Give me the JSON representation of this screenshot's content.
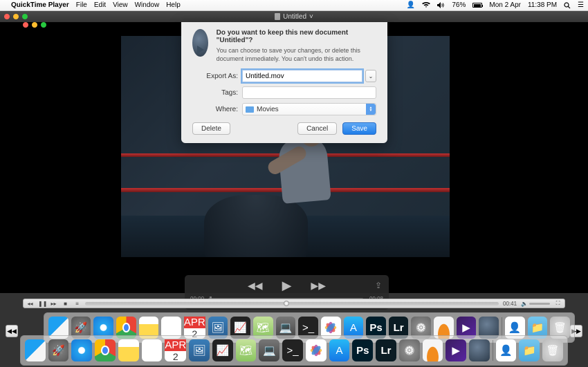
{
  "menubar": {
    "appname": "QuickTime Player",
    "items": [
      "File",
      "Edit",
      "View",
      "Window",
      "Help"
    ],
    "user_icon": "▲",
    "wifi": "wifi",
    "volume": "vol",
    "battery_pct": "76%",
    "date": "Mon 2 Apr",
    "time": "11:38 PM"
  },
  "window": {
    "title": "Untitled",
    "chevron": "˅"
  },
  "dialog": {
    "headline": "Do you want to keep this new document \"Untitled\"?",
    "subline": "You can choose to save your changes, or delete this document immediately. You can't undo this action.",
    "export_label": "Export As:",
    "export_value": "Untitled.mov",
    "tags_label": "Tags:",
    "where_label": "Where:",
    "where_value": "Movies",
    "delete": "Delete",
    "cancel": "Cancel",
    "save": "Save"
  },
  "qtcontrols": {
    "current": "00:00",
    "remaining": "-00:08"
  },
  "playerbar": {
    "elapsed": "00:41"
  },
  "calendar": {
    "month": "APR",
    "day": "2"
  }
}
